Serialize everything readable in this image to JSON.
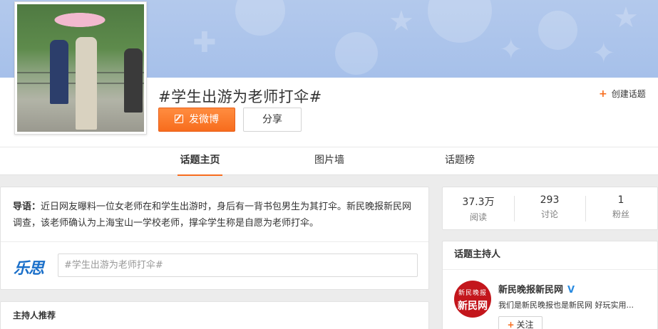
{
  "topic": {
    "title": "#学生出游为老师打伞#",
    "post_button": "发微博",
    "share_button": "分享",
    "create_topic": "创建话题"
  },
  "tabs": [
    {
      "label": "话题主页",
      "active": true
    },
    {
      "label": "图片墙",
      "active": false
    },
    {
      "label": "话题榜",
      "active": false
    }
  ],
  "intro": {
    "lead_label": "导语：",
    "text": "近日网友曝料一位女老师在和学生出游时，身后有一背书包男生为其打伞。新民晚报新民网调查，该老师确认为上海宝山一学校老师，撑伞学生称是自愿为老师打伞。"
  },
  "composer": {
    "logo": "乐思",
    "placeholder": "#学生出游为老师打伞#"
  },
  "host_recommend": {
    "title": "主持人推荐"
  },
  "stats": [
    {
      "value": "37.3万",
      "label": "阅读"
    },
    {
      "value": "293",
      "label": "讨论"
    },
    {
      "value": "1",
      "label": "粉丝"
    }
  ],
  "host": {
    "section_title": "话题主持人",
    "avatar_small": "新民晚报",
    "avatar_big": "新民网",
    "name": "新民晚报新民网",
    "verified_mark": "V",
    "description": "我们是新民晚报也是新民网 好玩实用...",
    "follow_label": "关注"
  },
  "colors": {
    "accent": "#f76c1d",
    "banner": "#a6c0ea",
    "verified": "#2a8be0",
    "brand_red": "#c3161c"
  }
}
